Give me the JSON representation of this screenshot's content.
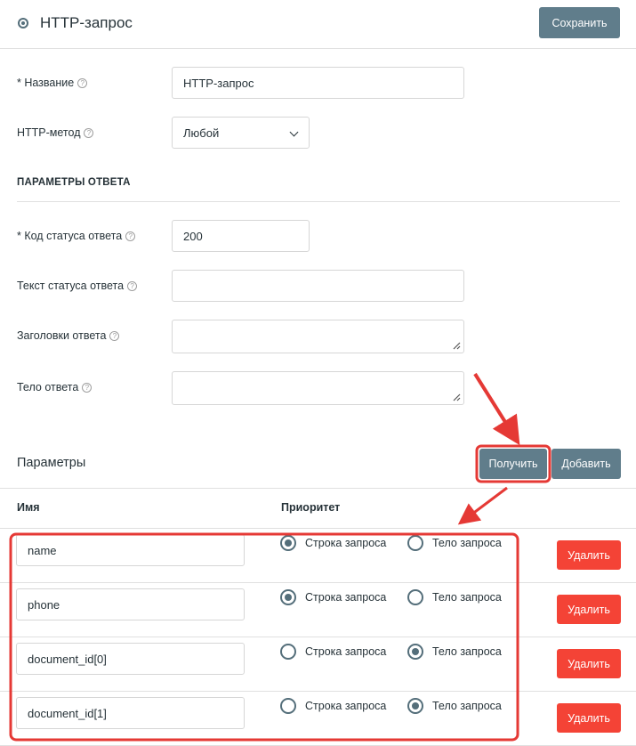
{
  "header": {
    "title": "HTTP-запрос",
    "save_label": "Сохранить"
  },
  "form": {
    "name_label": "* Название",
    "name_value": "HTTP-запрос",
    "method_label": "HTTP-метод",
    "method_value": "Любой"
  },
  "response": {
    "section_title": "ПАРАМЕТРЫ ОТВЕТА",
    "status_code_label": "* Код статуса ответа",
    "status_code_value": "200",
    "status_text_label": "Текст статуса ответа",
    "status_text_value": "",
    "headers_label": "Заголовки ответа",
    "headers_value": "",
    "body_label": "Тело ответа",
    "body_value": ""
  },
  "params": {
    "title": "Параметры",
    "fetch_label": "Получить",
    "add_label": "Добавить",
    "col_name": "Имя",
    "col_priority": "Приоритет",
    "option_query": "Строка запроса",
    "option_body": "Тело запроса",
    "delete_label": "Удалить",
    "rows": [
      {
        "name": "name",
        "priority": "query"
      },
      {
        "name": "phone",
        "priority": "query"
      },
      {
        "name": "document_id[0]",
        "priority": "body"
      },
      {
        "name": "document_id[1]",
        "priority": "body"
      }
    ]
  },
  "colors": {
    "grey_button": "#607d8b",
    "red_button": "#f44336",
    "annotation": "#e53935"
  }
}
